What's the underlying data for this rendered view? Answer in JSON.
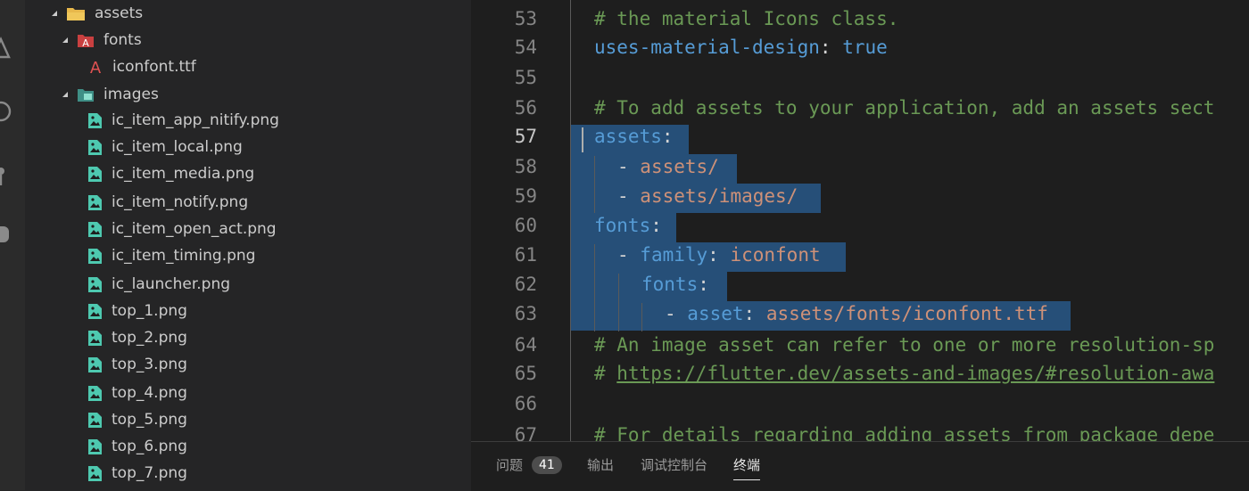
{
  "explorer": {
    "folder_assets": "assets",
    "folder_fonts": "fonts",
    "file_iconfont": "iconfont.ttf",
    "folder_images": "images",
    "image_files": [
      "ic_item_app_nitify.png",
      "ic_item_local.png",
      "ic_item_media.png",
      "ic_item_notify.png",
      "ic_item_open_act.png",
      "ic_item_timing.png",
      "ic_launcher.png",
      "top_1.png",
      "top_2.png",
      "top_3.png",
      "top_4.png",
      "top_5.png",
      "top_6.png",
      "top_7.png"
    ]
  },
  "editor": {
    "line_numbers": [
      "53",
      "54",
      "55",
      "56",
      "57",
      "58",
      "59",
      "60",
      "61",
      "62",
      "63",
      "64",
      "65",
      "66",
      "67"
    ],
    "lines": {
      "l53": "# the material Icons class.",
      "l54_key": "uses-material-design",
      "l54_colon": ":",
      "l54_val": "true",
      "l56": "# To add assets to your application, add an assets sect",
      "l57_key": "assets",
      "l57_colon": ":",
      "l58_dash": "- ",
      "l58_val": "assets/",
      "l59_dash": "- ",
      "l59_val": "assets/images/",
      "l60_key": "fonts",
      "l60_colon": ":",
      "l61_dash": "- ",
      "l61_key": "family",
      "l61_colon": ":",
      "l61_val": "iconfont",
      "l62_key": "fonts",
      "l62_colon": ":",
      "l63_dash": "- ",
      "l63_key": "asset",
      "l63_colon": ":",
      "l63_val": "assets/fonts/iconfont.ttf",
      "l64": "# An image asset can refer to one or more resolution-sp",
      "l65_hash": "# ",
      "l65_url": "https://flutter.dev/assets-and-images/#resolution-awa",
      "l67": "# For details regarding adding assets from package depe"
    }
  },
  "panel": {
    "tabs": {
      "problems": "问题",
      "problems_count": "41",
      "output": "输出",
      "debug_console": "调试控制台",
      "terminal": "终端"
    },
    "active_tab": "终端"
  },
  "colors": {
    "comment": "#6a9955",
    "key": "#569cd6",
    "string": "#ce9178",
    "selection": "#264f78",
    "folder_icon": "#e8b84b",
    "font_icon": "#e05252",
    "image_icon": "#4ec9b0"
  }
}
